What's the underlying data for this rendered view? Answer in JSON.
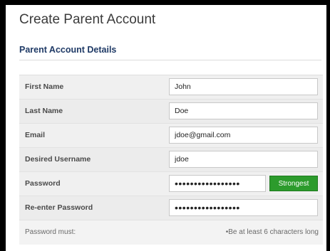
{
  "page": {
    "title": "Create Parent Account",
    "section_title": "Parent Account Details"
  },
  "form": {
    "fields": [
      {
        "label": "First Name",
        "value": "John"
      },
      {
        "label": "Last Name",
        "value": "Doe"
      },
      {
        "label": "Email",
        "value": "jdoe@gmail.com"
      },
      {
        "label": "Desired Username",
        "value": "jdoe"
      },
      {
        "label": "Password",
        "value": "•••••••••••••••••",
        "strength": "Strongest"
      },
      {
        "label": "Re-enter Password",
        "value": "•••••••••••••••••"
      }
    ],
    "requirements": {
      "label": "Password must:",
      "text": "•Be at least 6 characters long"
    }
  },
  "colors": {
    "strength_badge": "#2c9b2c",
    "section_title": "#1f3a66"
  }
}
